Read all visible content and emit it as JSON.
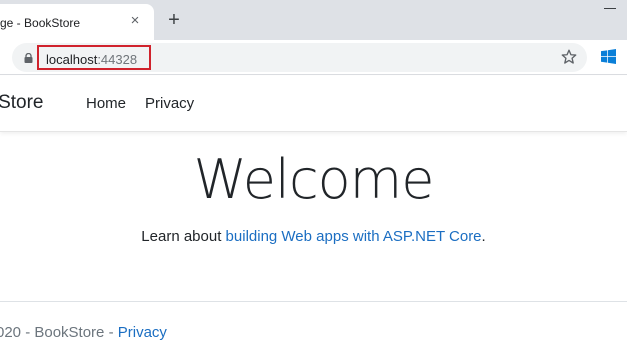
{
  "browser": {
    "tab_title": "ge - BookStore",
    "close_glyph": "×",
    "new_tab_glyph": "+",
    "url_host": "localhost",
    "url_port": ":44328",
    "highlight_color": "#d0222c"
  },
  "navbar": {
    "brand": "okStore",
    "home": "Home",
    "privacy": "Privacy"
  },
  "main": {
    "heading": "Welcome",
    "learn_prefix": "Learn about ",
    "learn_link": "building Web apps with ASP.NET Core",
    "learn_suffix": "."
  },
  "footer": {
    "copyright": "020 - BookStore - ",
    "privacy_link": "Privacy",
    "link_color": "#1b6ec2"
  },
  "icons": [
    "lock-icon",
    "star-icon",
    "windows-icon",
    "close-icon",
    "plus-icon"
  ]
}
